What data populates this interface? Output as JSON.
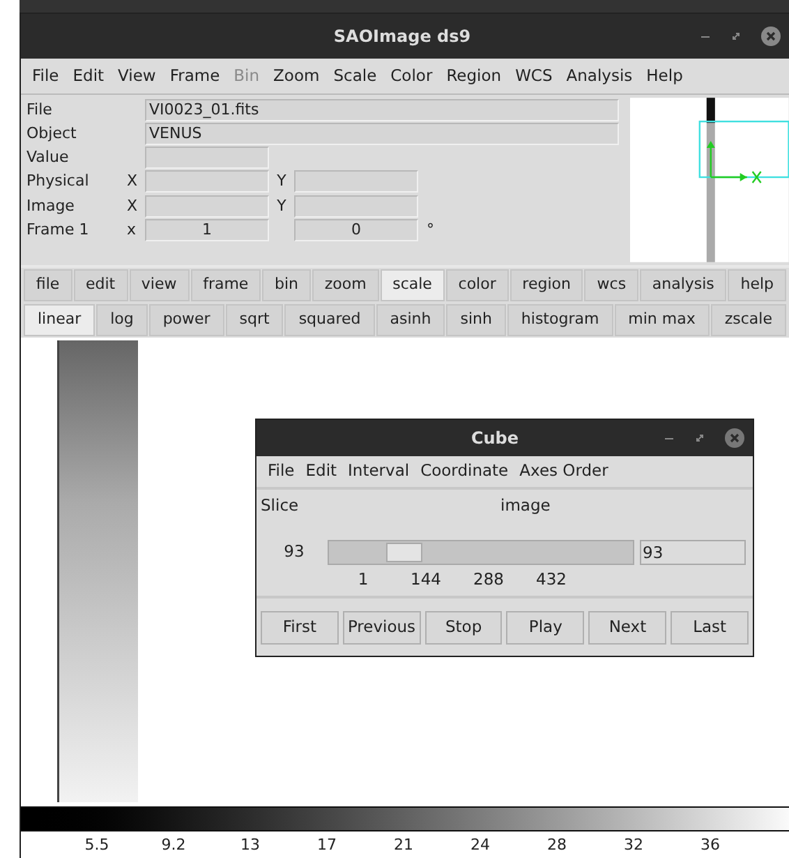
{
  "window": {
    "title": "SAOImage ds9"
  },
  "menu": [
    {
      "label": "File",
      "disabled": false
    },
    {
      "label": "Edit",
      "disabled": false
    },
    {
      "label": "View",
      "disabled": false
    },
    {
      "label": "Frame",
      "disabled": false
    },
    {
      "label": "Bin",
      "disabled": true
    },
    {
      "label": "Zoom",
      "disabled": false
    },
    {
      "label": "Scale",
      "disabled": false
    },
    {
      "label": "Color",
      "disabled": false
    },
    {
      "label": "Region",
      "disabled": false
    },
    {
      "label": "WCS",
      "disabled": false
    },
    {
      "label": "Analysis",
      "disabled": false
    },
    {
      "label": "Help",
      "disabled": false
    }
  ],
  "info": {
    "file": {
      "label": "File",
      "value": "VI0023_01.fits"
    },
    "object": {
      "label": "Object",
      "value": "VENUS"
    },
    "value": {
      "label": "Value"
    },
    "physical": {
      "label": "Physical",
      "x": "X",
      "y": "Y"
    },
    "image": {
      "label": "Image",
      "x": "X",
      "y": "Y"
    },
    "frame": {
      "label": "Frame 1",
      "x": "x",
      "zoom": "1",
      "angle": "0",
      "unit": "°"
    }
  },
  "button_bar": [
    {
      "label": "file",
      "selected": false
    },
    {
      "label": "edit",
      "selected": false
    },
    {
      "label": "view",
      "selected": false
    },
    {
      "label": "frame",
      "selected": false
    },
    {
      "label": "bin",
      "selected": false
    },
    {
      "label": "zoom",
      "selected": false
    },
    {
      "label": "scale",
      "selected": true
    },
    {
      "label": "color",
      "selected": false
    },
    {
      "label": "region",
      "selected": false
    },
    {
      "label": "wcs",
      "selected": false
    },
    {
      "label": "analysis",
      "selected": false
    },
    {
      "label": "help",
      "selected": false
    }
  ],
  "scale_buttons": [
    {
      "label": "linear",
      "selected": true
    },
    {
      "label": "log",
      "selected": false
    },
    {
      "label": "power",
      "selected": false
    },
    {
      "label": "sqrt",
      "selected": false
    },
    {
      "label": "squared",
      "selected": false
    },
    {
      "label": "asinh",
      "selected": false
    },
    {
      "label": "sinh",
      "selected": false
    },
    {
      "label": "histogram",
      "selected": false
    },
    {
      "label": "min max",
      "selected": false
    },
    {
      "label": "zscale",
      "selected": false
    }
  ],
  "colorbar": {
    "labels": [
      "5.5",
      "9.2",
      "13",
      "17",
      "21",
      "24",
      "28",
      "32",
      "36"
    ]
  },
  "cube": {
    "title": "Cube",
    "menu": [
      "File",
      "Edit",
      "Interval",
      "Coordinate",
      "Axes Order"
    ],
    "slice_label": "Slice",
    "coordinate": "image",
    "slice_value": "93",
    "slider": {
      "level": 0.21
    },
    "ticks": [
      "1",
      "144",
      "288",
      "432"
    ],
    "entry": "93",
    "buttons": [
      "First",
      "Previous",
      "Stop",
      "Play",
      "Next",
      "Last"
    ]
  }
}
